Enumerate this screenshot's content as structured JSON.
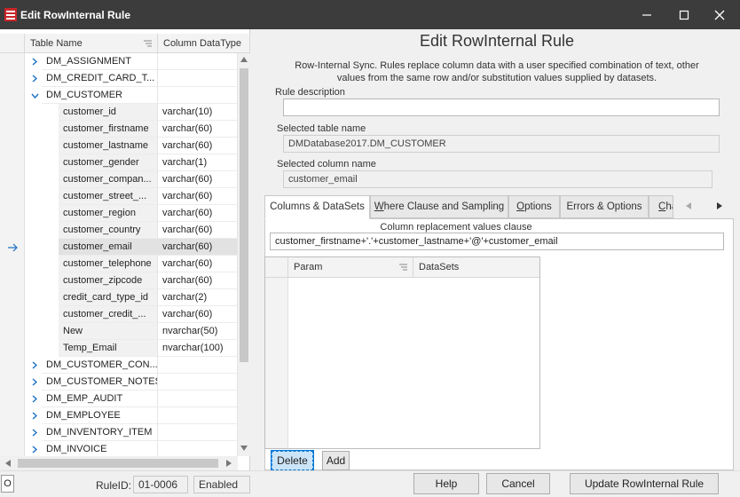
{
  "window": {
    "title": "Edit RowInternal Rule"
  },
  "grid": {
    "columns": [
      "Table Name",
      "Column DataType"
    ],
    "rows": [
      {
        "type": "table",
        "expanded": false,
        "name": "DM_ASSIGNMENT",
        "datatype": ""
      },
      {
        "type": "table",
        "expanded": false,
        "name": "DM_CREDIT_CARD_T...",
        "datatype": ""
      },
      {
        "type": "table",
        "expanded": true,
        "name": "DM_CUSTOMER",
        "datatype": ""
      },
      {
        "type": "column",
        "name": "customer_id",
        "datatype": "varchar(10)"
      },
      {
        "type": "column",
        "name": "customer_firstname",
        "datatype": "varchar(60)"
      },
      {
        "type": "column",
        "name": "customer_lastname",
        "datatype": "varchar(60)"
      },
      {
        "type": "column",
        "name": "customer_gender",
        "datatype": "varchar(1)"
      },
      {
        "type": "column",
        "name": "customer_compan...",
        "datatype": "varchar(60)"
      },
      {
        "type": "column",
        "name": "customer_street_...",
        "datatype": "varchar(60)"
      },
      {
        "type": "column",
        "name": "customer_region",
        "datatype": "varchar(60)"
      },
      {
        "type": "column",
        "name": "customer_country",
        "datatype": "varchar(60)"
      },
      {
        "type": "column",
        "name": "customer_email",
        "datatype": "varchar(60)",
        "selected": true
      },
      {
        "type": "column",
        "name": "customer_telephone",
        "datatype": "varchar(60)"
      },
      {
        "type": "column",
        "name": "customer_zipcode",
        "datatype": "varchar(60)"
      },
      {
        "type": "column",
        "name": "credit_card_type_id",
        "datatype": "varchar(2)"
      },
      {
        "type": "column",
        "name": "customer_credit_...",
        "datatype": "varchar(60)"
      },
      {
        "type": "column",
        "name": "New",
        "datatype": "nvarchar(50)"
      },
      {
        "type": "column",
        "name": "Temp_Email",
        "datatype": "nvarchar(100)"
      },
      {
        "type": "table",
        "expanded": false,
        "name": "DM_CUSTOMER_CON...",
        "datatype": ""
      },
      {
        "type": "table",
        "expanded": false,
        "name": "DM_CUSTOMER_NOTES",
        "datatype": ""
      },
      {
        "type": "table",
        "expanded": false,
        "name": "DM_EMP_AUDIT",
        "datatype": ""
      },
      {
        "type": "table",
        "expanded": false,
        "name": "DM_EMPLOYEE",
        "datatype": ""
      },
      {
        "type": "table",
        "expanded": false,
        "name": "DM_INVENTORY_ITEM",
        "datatype": ""
      },
      {
        "type": "table",
        "expanded": false,
        "name": "DM_INVOICE",
        "datatype": ""
      }
    ]
  },
  "form": {
    "heading": "Edit RowInternal Rule",
    "description": "Row-Internal Sync. Rules replace column data with a user specified combination of text, other values from the same row and/or substitution values supplied by datasets.",
    "rule_description_label": "Rule description",
    "rule_description_value": "",
    "selected_table_label": "Selected table name",
    "selected_table_value": "DMDatabase2017.DM_CUSTOMER",
    "selected_column_label": "Selected column name",
    "selected_column_value": "customer_email"
  },
  "tabs": [
    {
      "label": "Columns & DataSets",
      "active": true
    },
    {
      "label": "Where Clause and Sampling",
      "underline": "W"
    },
    {
      "label": "Options",
      "underline": "O"
    },
    {
      "label": "Errors & Options",
      "underline": ""
    },
    {
      "label": "Cha",
      "underline": "C"
    }
  ],
  "columns_tab": {
    "clause_label": "Column replacement values clause",
    "clause_value": "customer_firstname+'.'+customer_lastname+'@'+customer_email",
    "param_headers": [
      "Param",
      "DataSets"
    ],
    "delete_label": "Delete",
    "add_label": "Add"
  },
  "bottom": {
    "left_box": "O",
    "ruleid_label": "RuleID:",
    "ruleid_value": "01-0006",
    "status_value": "Enabled",
    "help_label": "Help",
    "cancel_label": "Cancel",
    "update_label": "Update RowInternal Rule"
  },
  "colors": {
    "titlebar": "#3c3c3c",
    "selected_row": "#e2e2e2",
    "accent": "#0078d7"
  }
}
